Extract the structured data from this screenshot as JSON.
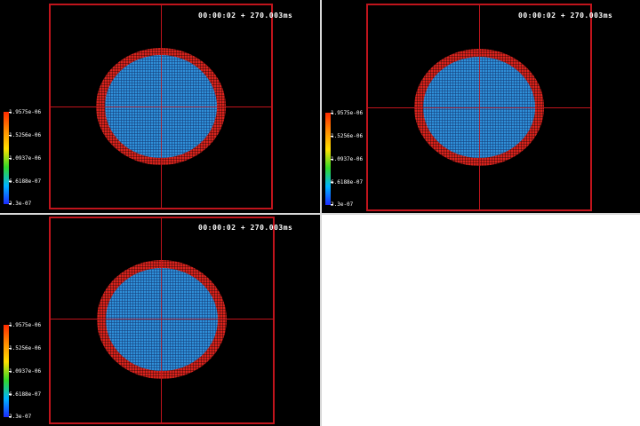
{
  "viewports": [
    {
      "timestamp": "00:00:02 + 270.003ms"
    },
    {
      "timestamp": "00:00:02 + 270.003ms"
    },
    {
      "timestamp": "00:00:02 + 270.003ms"
    }
  ],
  "legend": {
    "labels": [
      "1.9575e-06",
      "1.5256e-06",
      "1.0937e-06",
      "6.6188e-07",
      "2.3e-07"
    ]
  },
  "colors": {
    "background": "#000000",
    "frame": "#c0141c",
    "ring": "#d8231d",
    "fill": "#2f8fd8",
    "divider": "#d8d8d8"
  }
}
